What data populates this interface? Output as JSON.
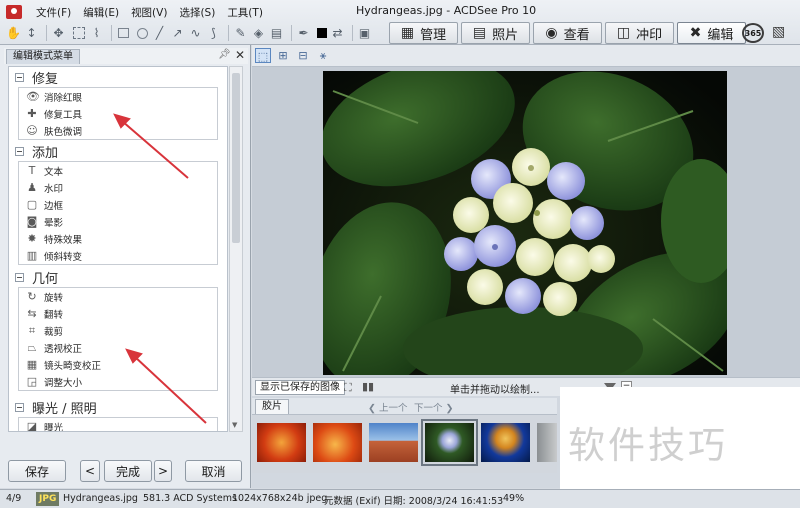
{
  "window": {
    "title": "Hydrangeas.jpg - ACDSee Pro 10"
  },
  "menu": [
    "文件(F)",
    "编辑(E)",
    "视图(V)",
    "选择(S)",
    "工具(T)"
  ],
  "mode_tabs": [
    {
      "label": "管理",
      "icon": "grid-icon"
    },
    {
      "label": "照片",
      "icon": "photos-icon"
    },
    {
      "label": "查看",
      "icon": "eye-icon"
    },
    {
      "label": "冲印",
      "icon": "develop-icon"
    },
    {
      "label": "编辑",
      "icon": "edit-tools-icon",
      "active": true
    }
  ],
  "panel": {
    "title": "编辑模式菜单",
    "sections": [
      {
        "title": "修复",
        "items": [
          {
            "label": "消除红眼",
            "icon": "eye-icon"
          },
          {
            "label": "修复工具",
            "icon": "bandage-icon"
          },
          {
            "label": "肤色微调",
            "icon": "person-icon"
          }
        ]
      },
      {
        "title": "添加",
        "items": [
          {
            "label": "文本",
            "icon": "text-icon"
          },
          {
            "label": "水印",
            "icon": "watermark-icon"
          },
          {
            "label": "边框",
            "icon": "border-icon"
          },
          {
            "label": "晕影",
            "icon": "vignette-icon"
          },
          {
            "label": "特殊效果",
            "icon": "effects-icon"
          },
          {
            "label": "倾斜转变",
            "icon": "tilt-shift-icon"
          }
        ]
      },
      {
        "title": "几何",
        "items": [
          {
            "label": "旋转",
            "icon": "rotate-icon"
          },
          {
            "label": "翻转",
            "icon": "flip-icon"
          },
          {
            "label": "裁剪",
            "icon": "crop-icon"
          },
          {
            "label": "透视校正",
            "icon": "perspective-icon"
          },
          {
            "label": "镜头畸变校正",
            "icon": "lens-distortion-icon"
          },
          {
            "label": "调整大小",
            "icon": "resize-icon"
          }
        ]
      },
      {
        "title": "曝光 / 照明",
        "items": [
          {
            "label": "曝光",
            "icon": "exposure-icon"
          }
        ]
      }
    ],
    "buttons": {
      "save": "保存",
      "prev": "<",
      "done": "完成",
      "next": ">",
      "cancel": "取消"
    }
  },
  "image_view": {
    "show_saved": "显示已保存的图像",
    "hint": "单击并拖动以绘制...",
    "zoom": "49%"
  },
  "filmstrip": {
    "tab": "胶片",
    "prev": "上一个",
    "next": "下一个",
    "thumbnails": [
      {
        "name": "thumb-orange-flower",
        "selected": false
      },
      {
        "name": "thumb-orange-flower-2",
        "selected": false
      },
      {
        "name": "thumb-desert",
        "selected": false
      },
      {
        "name": "thumb-hydrangeas",
        "selected": true
      },
      {
        "name": "thumb-jellyfish",
        "selected": false
      },
      {
        "name": "thumb-koala",
        "selected": false
      }
    ]
  },
  "watermark_text": "软件技巧",
  "statusbar": {
    "index": "4/9",
    "format": "JPG",
    "filename": "Hydrangeas.jpg",
    "filesize": "581.3 ACD Systems",
    "dimensions": "1024x768x24b jpeg",
    "metadata": "元数据 (Exif) 日期: 2008/3/24 16:41:53",
    "zoom": "49%"
  }
}
